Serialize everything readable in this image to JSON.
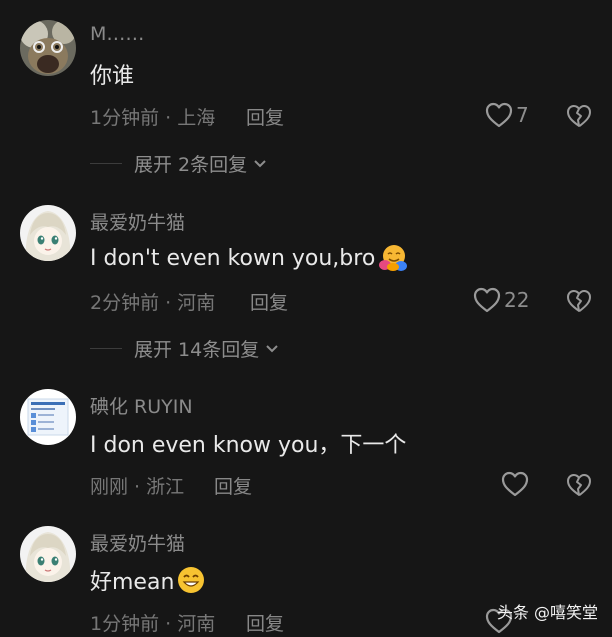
{
  "comments": [
    {
      "username": "M……",
      "text": "你谁",
      "time_location": "1分钟前 · 上海",
      "reply_label": "回复",
      "likes": "7",
      "expand_label": "展开 2条回复"
    },
    {
      "username": "最爱奶牛猫",
      "text": "I don't even kown you,bro",
      "emoji": "hugging-face",
      "time_location": "2分钟前 · 河南",
      "reply_label": "回复",
      "likes": "22",
      "expand_label": "展开 14条回复"
    },
    {
      "username": "碘化 RUYIN",
      "text": "I don even know you，下一个",
      "time_location": "刚刚 · 浙江",
      "reply_label": "回复",
      "likes": ""
    },
    {
      "username": "最爱奶牛猫",
      "text": "好mean",
      "emoji": "smiling-face",
      "time_location": "1分钟前 · 河南",
      "reply_label": "回复",
      "likes": ""
    }
  ],
  "watermark": "头条 @嘻笑堂",
  "colors": {
    "background": "#161616",
    "username": "#8a8a8a",
    "text": "#e9e9e9",
    "meta": "#777777",
    "icon": "#9a9a9a"
  }
}
